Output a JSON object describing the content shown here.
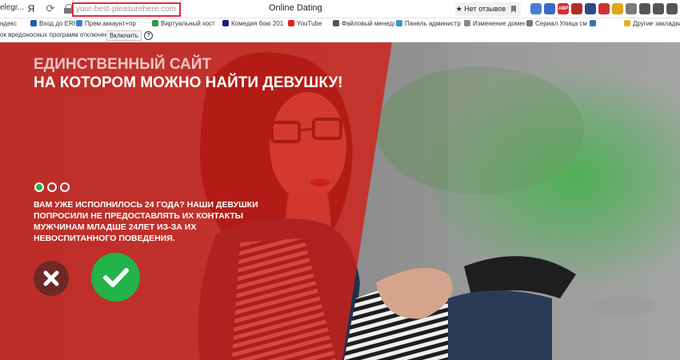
{
  "browser": {
    "tab_fragment": "elegr...",
    "yandex_label": "Я",
    "url": "your-best-pleasurehere.com",
    "page_title": "Online Dating",
    "reviews_label": "★ Нет отзывов",
    "extensions": [
      {
        "name": "ext-1",
        "color": "#4a7fd6"
      },
      {
        "name": "ext-2",
        "color": "#3c68c4"
      },
      {
        "name": "abp",
        "color": "#d8282e",
        "label": "ABP"
      },
      {
        "name": "ext-4",
        "color": "#b52b2b"
      },
      {
        "name": "ext-5",
        "color": "#2a4a88"
      },
      {
        "name": "ext-6",
        "color": "#cc3333"
      },
      {
        "name": "ext-7",
        "color": "#e0a51a"
      },
      {
        "name": "ext-8",
        "color": "#7a7a7a"
      },
      {
        "name": "ext-9",
        "color": "#555555"
      },
      {
        "name": "ext-10",
        "color": "#555555"
      },
      {
        "name": "ext-11",
        "color": "#555555"
      }
    ]
  },
  "bookmarks": [
    {
      "label": "ндекс",
      "color": "#d22"
    },
    {
      "label": "Вход до ERP - User",
      "color": "#1d5fb5"
    },
    {
      "label": "Прем.аккаунт+пр",
      "color": "#3a7fd0"
    },
    {
      "label": "Виртуальный хост",
      "color": "#2e9a3e"
    },
    {
      "label": "Комедия бою 201",
      "color": "#1a1a8c"
    },
    {
      "label": "YouTube",
      "color": "#e62117"
    },
    {
      "label": "Файловый менедж",
      "color": "#555"
    },
    {
      "label": "Панель администр",
      "color": "#3399cc"
    },
    {
      "label": "Изменение домен",
      "color": "#888"
    },
    {
      "label": "Сериал Улица см",
      "color": "#777"
    },
    {
      "label": "",
      "color": "#3a6fb0"
    },
    {
      "label": "Другие закладки",
      "color": "#e8b028"
    }
  ],
  "infobar": {
    "text": "ок вредоносных программ отключена",
    "enable_label": "Включить",
    "help_label": "?"
  },
  "hero": {
    "headline_line1": "ЕДИНСТВЕННЫЙ САЙТ",
    "headline_line2": "НА КОТОРОМ МОЖНО НАЙТИ ДЕВУШКУ!",
    "question_lines": [
      "ВАМ УЖЕ ИСПОЛНИЛОСЬ 24 ГОДА? НАШИ ДЕВУШКИ",
      "ПОПРОСИЛИ НЕ ПРЕДОСТАВЛЯТЬ ИХ КОНТАКТЫ",
      "МУЖЧИНАМ МЛАДШЕ 24ЛЕТ ИЗ-ЗА ИХ",
      "НЕВОСПИТАННОГО ПОВЕДЕНИЯ."
    ],
    "steps": {
      "total": 3,
      "active": 1
    },
    "colors": {
      "overlay": "#d21e16",
      "yes": "#22b34a",
      "no": "#6e2826"
    }
  }
}
